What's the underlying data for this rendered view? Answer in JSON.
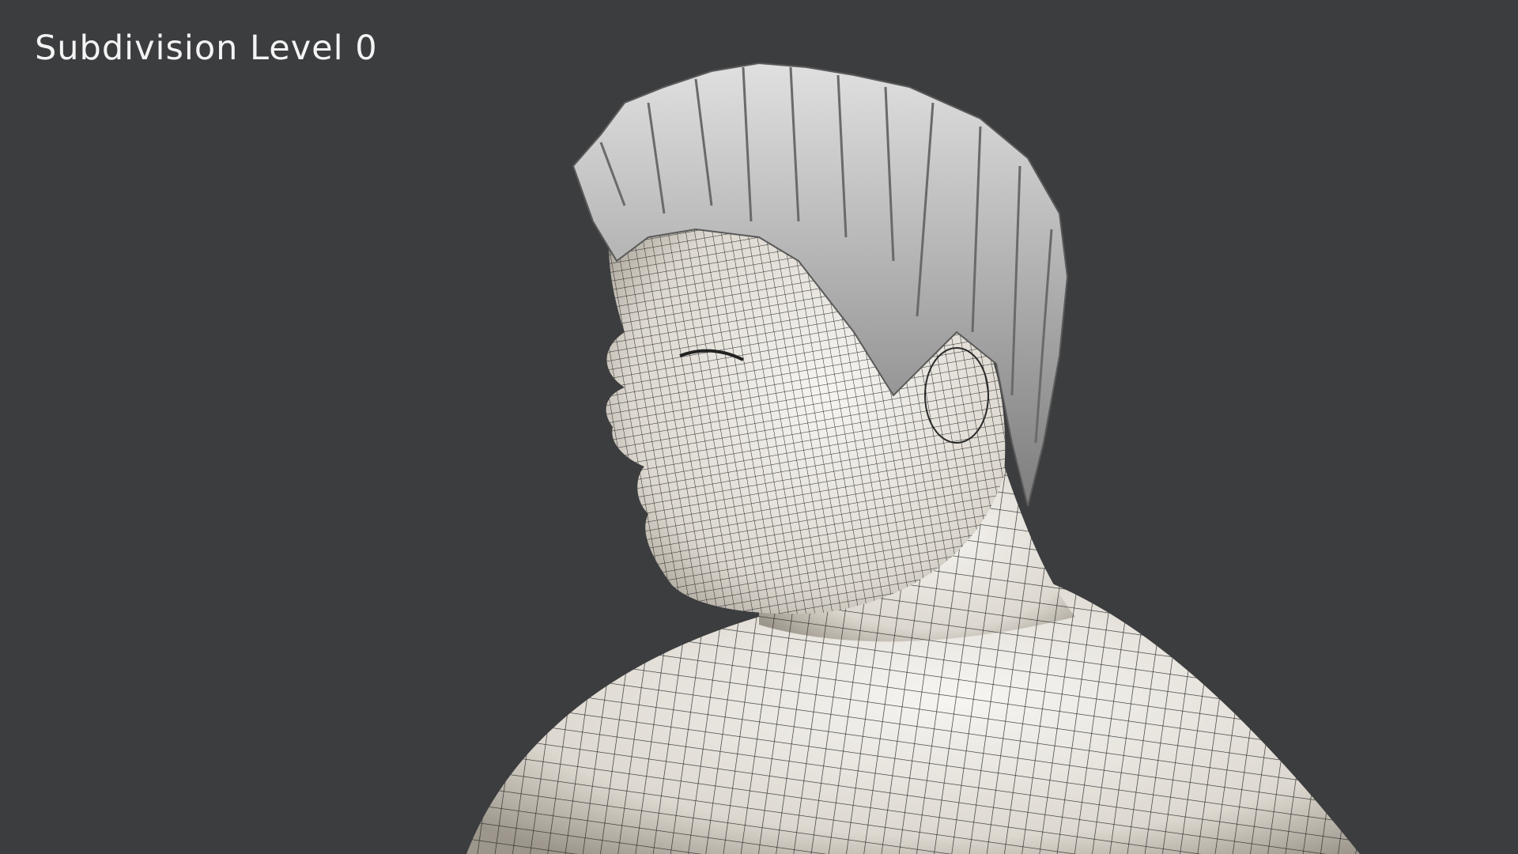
{
  "caption": "Subdivision Level 0",
  "colors": {
    "background": "#3c3d3f",
    "skin": "#e9e6e0",
    "wire": "#2a2a2a",
    "hair": "#b9b9b9"
  }
}
